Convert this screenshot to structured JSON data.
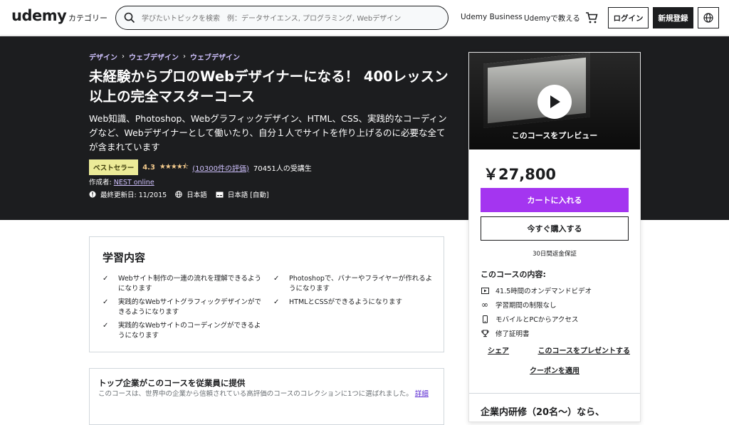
{
  "header": {
    "logo": "udemy",
    "category": "カテゴリー",
    "search_placeholder": "学びたいトピックを検索　例：データサイエンス, プログラミング, Webデザイン",
    "business": "Udemy Business",
    "teach": "Udemyで教える",
    "login": "ログイン",
    "signup": "新規登録"
  },
  "breadcrumbs": [
    "デザイン",
    "ウェブデザイン",
    "ウェブデザイン"
  ],
  "course": {
    "title": "未経験からプロのWebデザイナーになる！ 400レッスン以上の完全マスターコース",
    "subtitle": "Web知識、Photoshop、Webグラフィックデザイン、HTML、CSS、実践的なコーディングなど、Webデザイナーとして働いたり、自分１人でサイトを作り上げるのに必要な全てが含まれています",
    "badge": "ベストセラー",
    "rating": "4.3",
    "rating_value": 4.3,
    "stars": "★★★★⯪",
    "reviews": "(10300件の評価)",
    "students": "70451人の受講生",
    "author_label": "作成者:",
    "author": "NEST online",
    "updated": "最終更新日: 11/2015",
    "language": "日本語",
    "captions": "日本語 [自動]"
  },
  "sidebar": {
    "preview_label": "このコースをプレビュー",
    "price": "￥27,800",
    "add_to_cart": "カートに入れる",
    "buy_now": "今すぐ購入する",
    "guarantee": "30日間返金保証",
    "includes_title": "このコースの内容:",
    "includes": [
      {
        "icon": "video-icon",
        "text": "41.5時間のオンデマンドビデオ"
      },
      {
        "icon": "infinity-icon",
        "text": "学習期間の制限なし"
      },
      {
        "icon": "mobile-icon",
        "text": "モバイルとPCからアクセス"
      },
      {
        "icon": "trophy-icon",
        "text": "修了証明書"
      }
    ],
    "share": "シェア",
    "gift": "このコースをプレゼントする",
    "coupon": "クーポンを適用",
    "corp_title": "企業内研修（20名〜）なら、"
  },
  "learn": {
    "title": "学習内容",
    "items": [
      "Webサイト制作の一連の流れを理解できるようになります",
      "Photoshopで、バナーやフライヤーが作れるようになります",
      "実践的なWebサイトグラフィックデザインができるようになります",
      "HTMLとCSSができるようになります",
      "実践的なWebサイトのコーディングができるようになります"
    ]
  },
  "corp_box": {
    "title": "トップ企業がこのコースを従業員に提供",
    "desc": "このコースは、世界中の企業から信頼されている高評価のコースのコレクションに1つに選ばれました。",
    "link": "詳細"
  },
  "colors": {
    "accent": "#a435f0",
    "dark": "#1c1d1f",
    "link_light": "#cec0fc",
    "star": "#f3ca8c",
    "badge": "#eceb98"
  }
}
